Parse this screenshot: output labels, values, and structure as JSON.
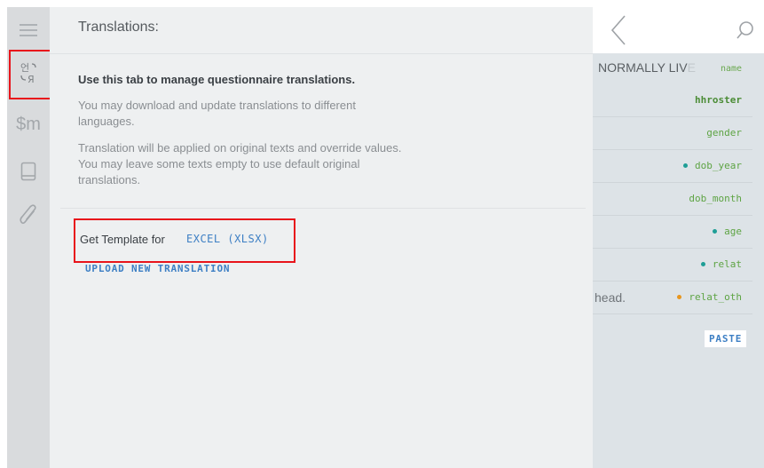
{
  "rail": {
    "items": [
      {
        "name": "menu"
      },
      {
        "name": "translations",
        "glyph": "언 ℵ"
      },
      {
        "name": "macros",
        "label": "$m"
      },
      {
        "name": "book"
      },
      {
        "name": "attachments"
      }
    ]
  },
  "panel": {
    "title": "Translations:",
    "intro_bold": "Use this tab to manage questionnaire translations.",
    "intro_p1": "You may download and update translations to different languages.",
    "intro_p2": "Translation will be applied on original texts and override values. You may leave some texts empty to use default original translations.",
    "template_label": "Get Template for",
    "template_link": "EXCEL (XLSX)",
    "upload_link": "UPLOAD NEW TRANSLATION"
  },
  "right": {
    "header_text": "NORMALLY LIV",
    "header_fade": "E",
    "header_var": "name",
    "rows": [
      {
        "var": "hhroster",
        "bold": true,
        "dot": ""
      },
      {
        "var": "gender",
        "bold": false,
        "dot": ""
      },
      {
        "var": "dob_year",
        "bold": false,
        "dot": "#1e9e96"
      },
      {
        "var": "dob_month",
        "bold": false,
        "dot": ""
      },
      {
        "var": "age",
        "bold": false,
        "dot": "#1e9e96"
      },
      {
        "var": "relat",
        "bold": false,
        "dot": "#1e9e96"
      },
      {
        "var": "relat_oth",
        "bold": false,
        "dot": "#e8961e",
        "head": "head."
      }
    ],
    "paste_label": "PASTE"
  },
  "colors": {
    "accent": "#3d7fc4",
    "highlight": "#e8141b",
    "var_green": "#5ea444"
  }
}
